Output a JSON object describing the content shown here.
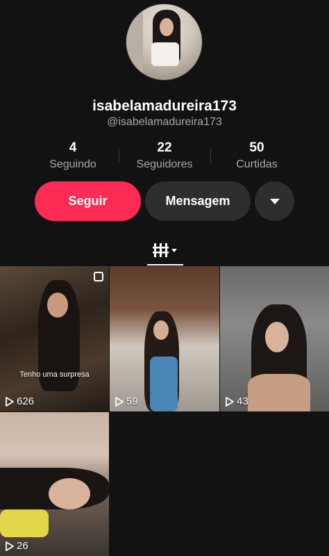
{
  "profile": {
    "username": "isabelamadureira173",
    "handle": "@isabelamadureira173"
  },
  "stats": [
    {
      "value": "4",
      "label": "Seguindo"
    },
    {
      "value": "22",
      "label": "Seguidores"
    },
    {
      "value": "50",
      "label": "Curtidas"
    }
  ],
  "actions": {
    "follow_label": "Seguir",
    "message_label": "Mensagem"
  },
  "videos": [
    {
      "views": "626",
      "caption": "Tenho uma surpresa"
    },
    {
      "views": "59"
    },
    {
      "views": "43"
    },
    {
      "views": "26"
    }
  ],
  "colors": {
    "follow_button": "#fe2c55",
    "background": "#121212",
    "secondary_button": "#2e2e2e"
  }
}
